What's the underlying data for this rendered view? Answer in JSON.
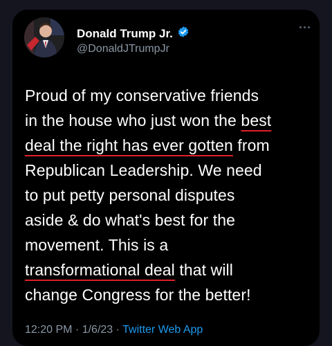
{
  "author": {
    "name": "Donald Trump Jr.",
    "handle": "@DonaldJTrumpJr",
    "verified": true
  },
  "tweet_lines": [
    [
      {
        "t": "Proud of my conservative friends"
      }
    ],
    [
      {
        "t": "in the house who just won the "
      },
      {
        "t": "best",
        "u": true
      }
    ],
    [
      {
        "t": "deal the right has ever gotten",
        "u": true
      },
      {
        "t": " from"
      }
    ],
    [
      {
        "t": "Republican Leadership. We need"
      }
    ],
    [
      {
        "t": "to put petty personal disputes"
      }
    ],
    [
      {
        "t": "aside & do what's best for the"
      }
    ],
    [
      {
        "t": "movement. This is a"
      }
    ],
    [
      {
        "t": "transformational deal",
        "u": true
      },
      {
        "t": " that will"
      }
    ],
    [
      {
        "t": "change Congress for the better!"
      }
    ]
  ],
  "footer": {
    "time": "12:20 PM",
    "sep1": " · ",
    "date": "1/6/23",
    "sep2": " · ",
    "app": "Twitter Web App"
  },
  "colors": {
    "background": "#000000",
    "link": "#1d9bf0",
    "underline": "#e0202a",
    "muted": "#8b98a5"
  },
  "icons": [
    "verified-badge-icon",
    "more-options-icon"
  ]
}
